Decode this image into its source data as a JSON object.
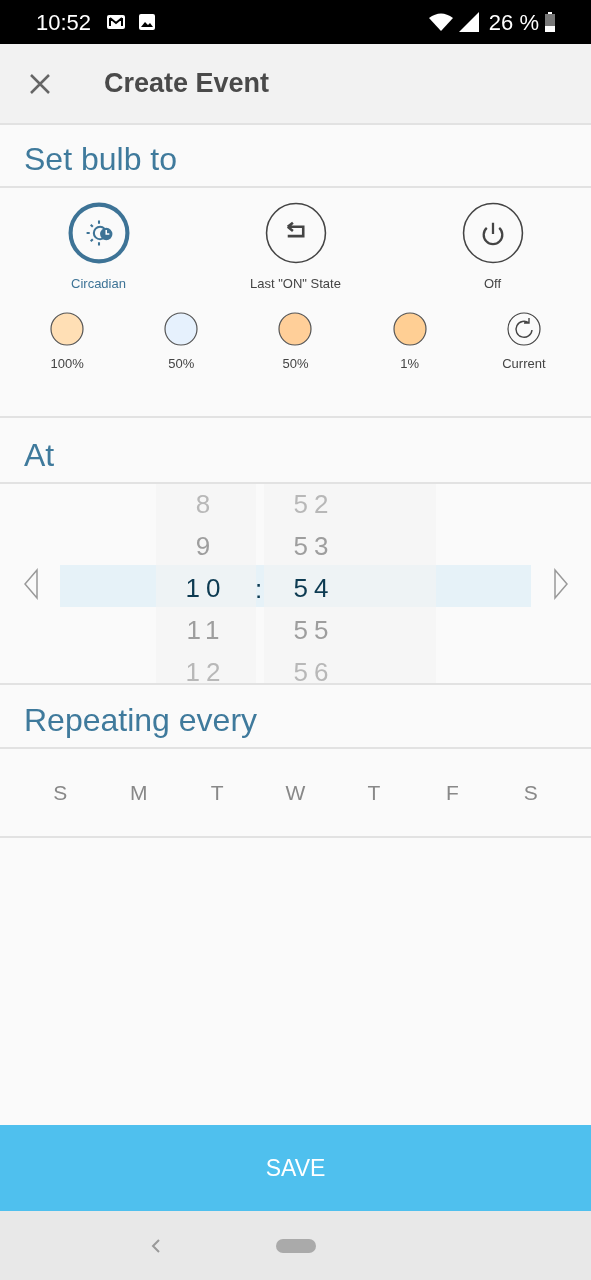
{
  "status_bar": {
    "time": "10:52",
    "battery": "26 %"
  },
  "app_bar": {
    "title": "Create Event"
  },
  "bulb_section": {
    "title": "Set bulb to",
    "modes": [
      {
        "kind": "circadian",
        "label": "Circadian",
        "selected": true
      },
      {
        "kind": "last",
        "label": "Last \"ON\" State",
        "selected": false
      },
      {
        "kind": "off",
        "label": "Off",
        "selected": false
      }
    ],
    "presets": [
      {
        "kind": "swatch",
        "label": "100%",
        "color": "#ffdfb5"
      },
      {
        "kind": "swatch",
        "label": "50%",
        "color": "#e6f1fd"
      },
      {
        "kind": "swatch",
        "label": "50%",
        "color": "#ffcf99"
      },
      {
        "kind": "swatch",
        "label": "1%",
        "color": "#ffcf94"
      },
      {
        "kind": "current",
        "label": "Current"
      }
    ]
  },
  "time_section": {
    "title": "At",
    "separator": ":",
    "hours": [
      {
        "label": "8",
        "selected": false
      },
      {
        "label": "9",
        "selected": false
      },
      {
        "label": "10",
        "selected": true
      },
      {
        "label": "11",
        "selected": false
      },
      {
        "label": "12",
        "selected": false
      }
    ],
    "minutes": [
      {
        "label": "52",
        "selected": false
      },
      {
        "label": "53",
        "selected": false
      },
      {
        "label": "54",
        "selected": true
      },
      {
        "label": "55",
        "selected": false
      },
      {
        "label": "56",
        "selected": false
      }
    ]
  },
  "repeat_section": {
    "title": "Repeating every",
    "days": [
      {
        "label": "S",
        "selected": false
      },
      {
        "label": "M",
        "selected": false
      },
      {
        "label": "T",
        "selected": false
      },
      {
        "label": "W",
        "selected": false
      },
      {
        "label": "T",
        "selected": false
      },
      {
        "label": "F",
        "selected": false
      },
      {
        "label": "S",
        "selected": false
      }
    ]
  },
  "save_button": {
    "label": "SAVE"
  }
}
